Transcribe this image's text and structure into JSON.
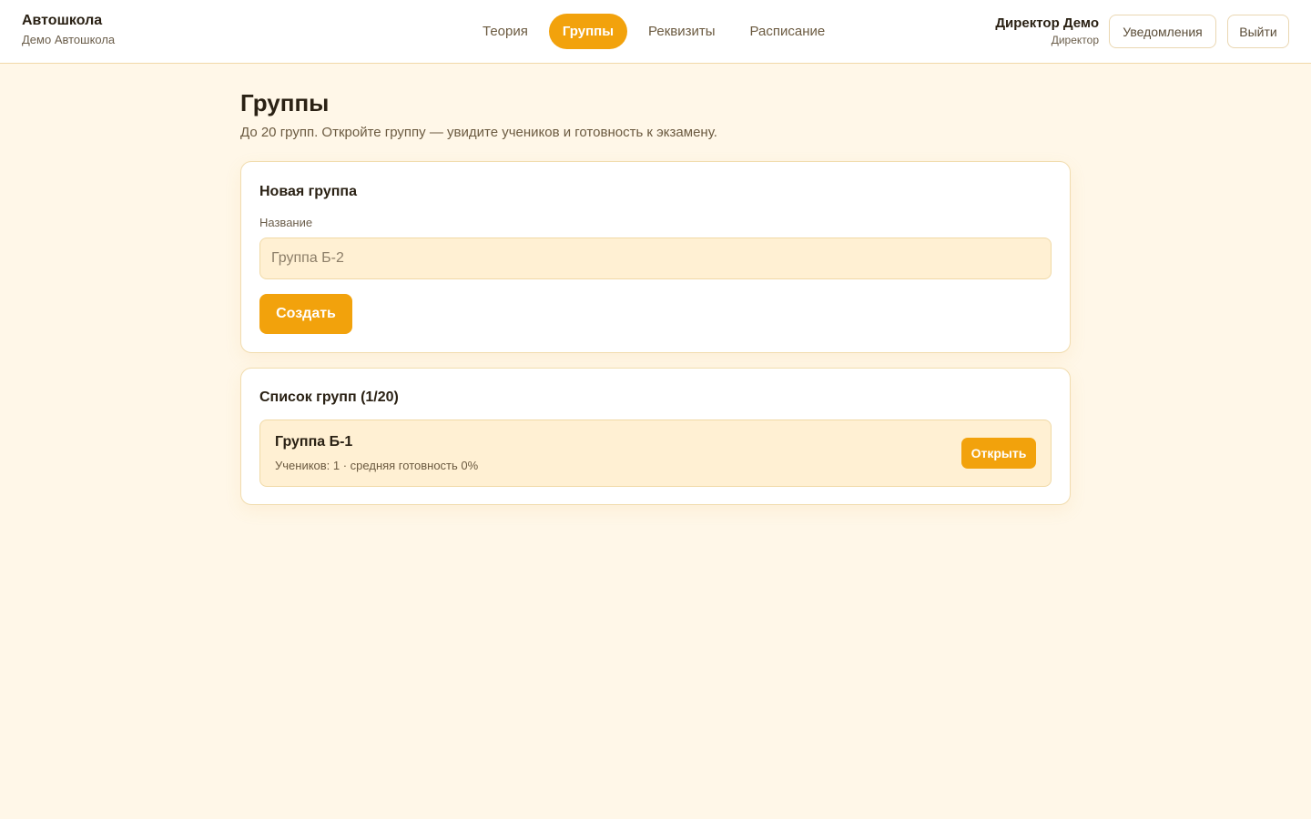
{
  "brand": {
    "title": "Автошкола",
    "subtitle": "Демо Автошкола"
  },
  "nav": {
    "tabs": [
      {
        "label": "Теория",
        "active": false
      },
      {
        "label": "Группы",
        "active": true
      },
      {
        "label": "Реквизиты",
        "active": false
      },
      {
        "label": "Расписание",
        "active": false
      }
    ]
  },
  "user": {
    "name": "Директор Демо",
    "role": "Директор"
  },
  "header_buttons": {
    "notifications": "Уведомления",
    "logout": "Выйти"
  },
  "page": {
    "title": "Группы",
    "subtitle": "До 20 групп. Откройте группу — увидите учеников и готовность к экзамену."
  },
  "new_group": {
    "title": "Новая группа",
    "name_label": "Название",
    "name_value": "",
    "name_placeholder": "Группа Б-2",
    "create_label": "Создать"
  },
  "group_list": {
    "title": "Список групп (1/20)",
    "items": [
      {
        "name": "Группа Б-1",
        "meta": "Учеников: 1 · средняя готовность 0%",
        "open_label": "Открыть"
      }
    ]
  },
  "colors": {
    "accent": "#f2a20c",
    "background": "#fff7e8",
    "input_background": "#fff0d3",
    "border": "#f1dcae"
  }
}
